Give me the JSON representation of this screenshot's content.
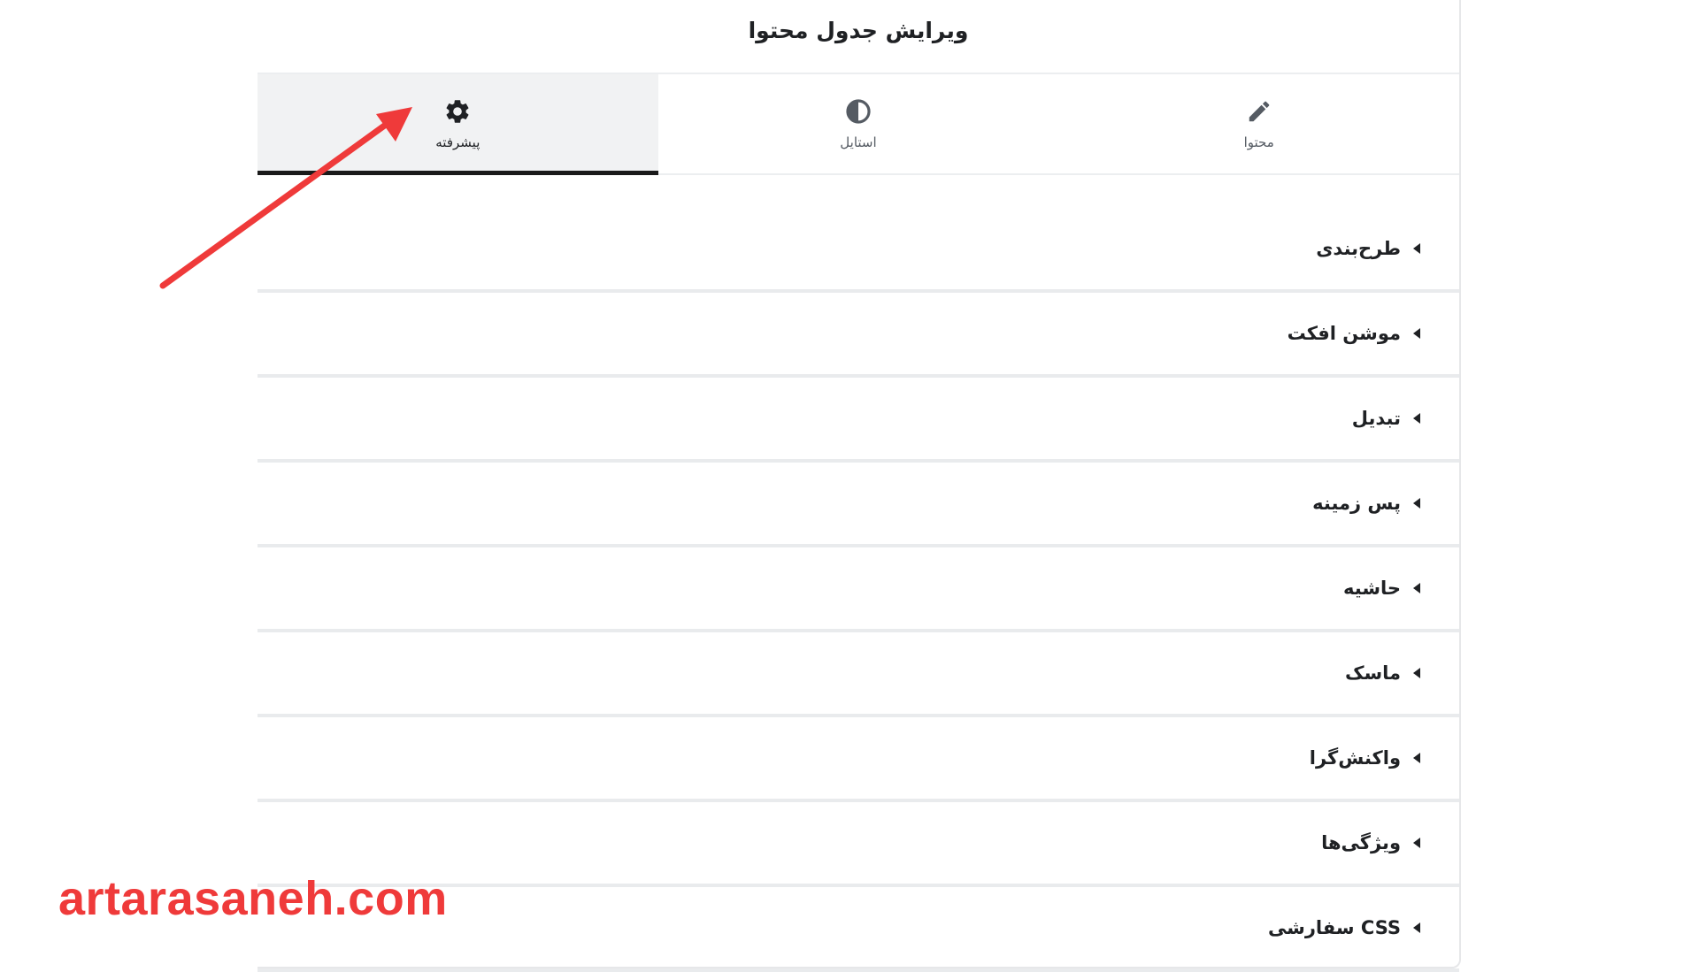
{
  "panel": {
    "title": "ویرایش جدول محتوا"
  },
  "tabs": [
    {
      "label": "محتوا",
      "icon": "pencil-icon",
      "active": false
    },
    {
      "label": "استایل",
      "icon": "contrast-icon",
      "active": false
    },
    {
      "label": "پیشرفته",
      "icon": "gear-icon",
      "active": true
    }
  ],
  "sections": [
    {
      "label": "طرح‌بندی"
    },
    {
      "label": "موشن افکت"
    },
    {
      "label": "تبدیل"
    },
    {
      "label": "پس زمینه"
    },
    {
      "label": "حاشیه"
    },
    {
      "label": "ماسک"
    },
    {
      "label": "واکنش‌گرا"
    },
    {
      "label": "ویژگی‌ها"
    },
    {
      "label": "CSS سفارشی"
    }
  ],
  "watermark": "artarasaneh.com",
  "colors": {
    "accent_arrow": "#ef3a3a",
    "active_tab_bg": "#f1f2f3",
    "active_indicator": "#1a1a1a"
  }
}
